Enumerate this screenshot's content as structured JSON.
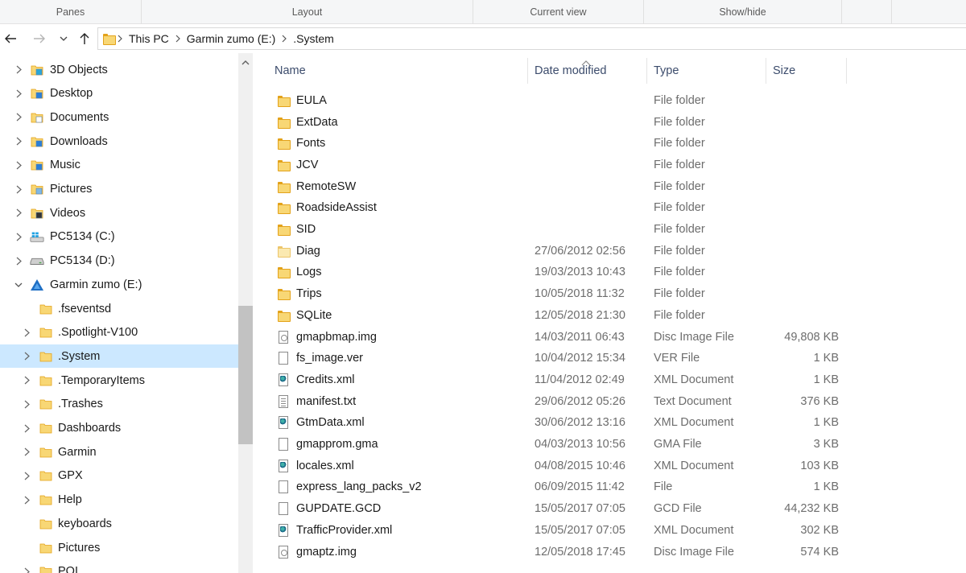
{
  "ribbon": {
    "groups": [
      "Panes",
      "Layout",
      "Current view",
      "Show/hide"
    ]
  },
  "address": {
    "crumbs": [
      "This PC",
      "Garmin zumo (E:)",
      ".System"
    ]
  },
  "nav_icons": {
    "back": "back-arrow-icon",
    "forward": "forward-arrow-icon",
    "recent": "chevron-down-icon",
    "up": "up-arrow-icon"
  },
  "tree": [
    {
      "label": "3D Objects",
      "icon": "3d-objects-icon",
      "expander": "collapsed"
    },
    {
      "label": "Desktop",
      "icon": "desktop-folder-icon",
      "expander": "collapsed"
    },
    {
      "label": "Documents",
      "icon": "documents-folder-icon",
      "expander": "collapsed"
    },
    {
      "label": "Downloads",
      "icon": "downloads-folder-icon",
      "expander": "collapsed"
    },
    {
      "label": "Music",
      "icon": "music-folder-icon",
      "expander": "collapsed"
    },
    {
      "label": "Pictures",
      "icon": "pictures-folder-icon",
      "expander": "collapsed"
    },
    {
      "label": "Videos",
      "icon": "videos-folder-icon",
      "expander": "collapsed"
    },
    {
      "label": "PC5134 (C:)",
      "icon": "windows-drive-icon",
      "expander": "collapsed"
    },
    {
      "label": "PC5134 (D:)",
      "icon": "drive-icon",
      "expander": "collapsed"
    },
    {
      "label": "Garmin zumo (E:)",
      "icon": "garmin-drive-icon",
      "expander": "expanded"
    },
    {
      "label": ".fseventsd",
      "icon": "folder-icon",
      "expander": "none"
    },
    {
      "label": ".Spotlight-V100",
      "icon": "folder-icon",
      "expander": "collapsed"
    },
    {
      "label": ".System",
      "icon": "folder-icon",
      "expander": "collapsed",
      "selected": true
    },
    {
      "label": ".TemporaryItems",
      "icon": "folder-icon",
      "expander": "collapsed"
    },
    {
      "label": ".Trashes",
      "icon": "folder-icon",
      "expander": "collapsed"
    },
    {
      "label": "Dashboards",
      "icon": "folder-icon",
      "expander": "collapsed"
    },
    {
      "label": "Garmin",
      "icon": "folder-icon",
      "expander": "collapsed"
    },
    {
      "label": "GPX",
      "icon": "folder-icon",
      "expander": "collapsed"
    },
    {
      "label": "Help",
      "icon": "folder-icon",
      "expander": "collapsed"
    },
    {
      "label": "keyboards",
      "icon": "folder-icon",
      "expander": "none"
    },
    {
      "label": "Pictures",
      "icon": "folder-icon",
      "expander": "none"
    },
    {
      "label": "POI",
      "icon": "folder-icon",
      "expander": "collapsed"
    }
  ],
  "columns": [
    "Name",
    "Date modified",
    "Type",
    "Size"
  ],
  "files": [
    {
      "name": "EULA",
      "date": "",
      "type": "File folder",
      "size": "",
      "icon": "folder-icon"
    },
    {
      "name": "ExtData",
      "date": "",
      "type": "File folder",
      "size": "",
      "icon": "folder-icon"
    },
    {
      "name": "Fonts",
      "date": "",
      "type": "File folder",
      "size": "",
      "icon": "folder-icon"
    },
    {
      "name": "JCV",
      "date": "",
      "type": "File folder",
      "size": "",
      "icon": "folder-icon"
    },
    {
      "name": "RemoteSW",
      "date": "",
      "type": "File folder",
      "size": "",
      "icon": "folder-icon"
    },
    {
      "name": "RoadsideAssist",
      "date": "",
      "type": "File folder",
      "size": "",
      "icon": "folder-icon"
    },
    {
      "name": "SID",
      "date": "",
      "type": "File folder",
      "size": "",
      "icon": "folder-icon"
    },
    {
      "name": "Diag",
      "date": "27/06/2012 02:56",
      "type": "File folder",
      "size": "",
      "icon": "folder-light-icon"
    },
    {
      "name": "Logs",
      "date": "19/03/2013 10:43",
      "type": "File folder",
      "size": "",
      "icon": "folder-icon"
    },
    {
      "name": "Trips",
      "date": "10/05/2018 11:32",
      "type": "File folder",
      "size": "",
      "icon": "folder-icon"
    },
    {
      "name": "SQLite",
      "date": "12/05/2018 21:30",
      "type": "File folder",
      "size": "",
      "icon": "folder-icon"
    },
    {
      "name": "gmapbmap.img",
      "date": "14/03/2011 06:43",
      "type": "Disc Image File",
      "size": "49,808 KB",
      "icon": "disc-image-file-icon"
    },
    {
      "name": "fs_image.ver",
      "date": "10/04/2012 15:34",
      "type": "VER File",
      "size": "1 KB",
      "icon": "blank-file-icon"
    },
    {
      "name": "Credits.xml",
      "date": "11/04/2012 02:49",
      "type": "XML Document",
      "size": "1 KB",
      "icon": "xml-file-icon"
    },
    {
      "name": "manifest.txt",
      "date": "29/06/2012 05:26",
      "type": "Text Document",
      "size": "376 KB",
      "icon": "text-file-icon"
    },
    {
      "name": "GtmData.xml",
      "date": "30/06/2012 13:16",
      "type": "XML Document",
      "size": "1 KB",
      "icon": "xml-file-icon"
    },
    {
      "name": "gmapprom.gma",
      "date": "04/03/2013 10:56",
      "type": "GMA File",
      "size": "3 KB",
      "icon": "blank-file-icon"
    },
    {
      "name": "locales.xml",
      "date": "04/08/2015 10:46",
      "type": "XML Document",
      "size": "103 KB",
      "icon": "xml-file-icon"
    },
    {
      "name": "express_lang_packs_v2",
      "date": "06/09/2015 11:42",
      "type": "File",
      "size": "1 KB",
      "icon": "blank-file-icon"
    },
    {
      "name": "GUPDATE.GCD",
      "date": "15/05/2017 07:05",
      "type": "GCD File",
      "size": "44,232 KB",
      "icon": "blank-file-icon"
    },
    {
      "name": "TrafficProvider.xml",
      "date": "15/05/2017 07:05",
      "type": "XML Document",
      "size": "302 KB",
      "icon": "xml-file-icon"
    },
    {
      "name": "gmaptz.img",
      "date": "12/05/2018 17:45",
      "type": "Disc Image File",
      "size": "574 KB",
      "icon": "disc-image-file-icon"
    }
  ],
  "colors": {
    "selection": "#cce8ff",
    "header_text": "#3c4c6c",
    "secondary_text": "#6d6d6d",
    "folder_fill": "#f8d775",
    "folder_edge": "#e3a21a"
  }
}
